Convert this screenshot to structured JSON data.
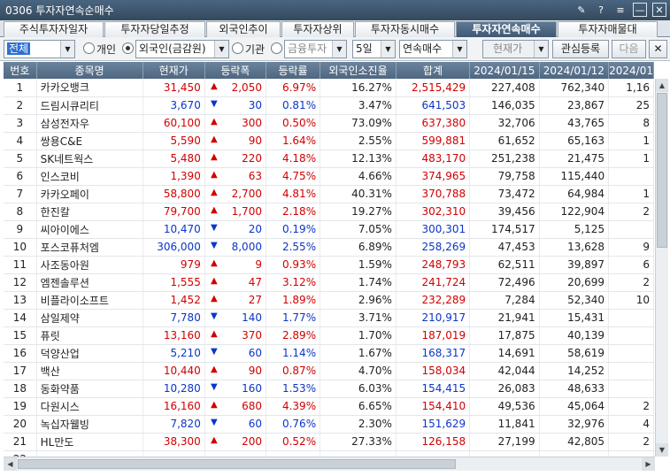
{
  "window": {
    "title": "0306 투자자연속순매수",
    "icons": [
      "pin-icon",
      "help-icon",
      "menu-icon",
      "minimize-icon",
      "close-icon"
    ],
    "icon_glyphs": {
      "pin": "✎",
      "help": "?",
      "menu": "≡",
      "minimize": "—",
      "close": "✕"
    }
  },
  "tabs": [
    {
      "label": "주식투자자일자",
      "active": false
    },
    {
      "label": "투자자당일추정",
      "active": false
    },
    {
      "label": "외국인추이",
      "active": false
    },
    {
      "label": "투자자상위",
      "active": false
    },
    {
      "label": "투자자동시매수",
      "active": false
    },
    {
      "label": "투자자연속매수",
      "active": true
    },
    {
      "label": "투자자매물대",
      "active": false
    }
  ],
  "filters": {
    "market": "전체",
    "radio_individual": "개인",
    "radio_foreign": "외국인(금감원)",
    "radio_institution": "기관",
    "institution_type": "금융투자",
    "period": "5일",
    "mode": "연속매수",
    "price_option": "현재가",
    "watchlist_button": "관심등록",
    "next_button": "다음",
    "selected_radio": "foreign"
  },
  "table": {
    "columns": [
      "번호",
      "종목명",
      "현재가",
      "등락폭",
      "등락률",
      "외국인소진율",
      "합계",
      "2024/01/15",
      "2024/01/12",
      "2024/01"
    ],
    "rows": [
      {
        "no": "1",
        "name": "카카오뱅크",
        "price": "31,450",
        "dir": "up",
        "chg": "2,050",
        "rate": "6.97%",
        "exh": "16.27%",
        "total": "2,515,429",
        "d1": "227,408",
        "d2": "762,340",
        "d3": "1,16"
      },
      {
        "no": "2",
        "name": "드림시큐리티",
        "price": "3,670",
        "dir": "down",
        "chg": "30",
        "rate": "0.81%",
        "exh": "3.47%",
        "total": "641,503",
        "d1": "146,035",
        "d2": "23,867",
        "d3": "25"
      },
      {
        "no": "3",
        "name": "삼성전자우",
        "price": "60,100",
        "dir": "up",
        "chg": "300",
        "rate": "0.50%",
        "exh": "73.09%",
        "total": "637,380",
        "d1": "32,706",
        "d2": "43,765",
        "d3": "8"
      },
      {
        "no": "4",
        "name": "쌍용C&E",
        "price": "5,590",
        "dir": "up",
        "chg": "90",
        "rate": "1.64%",
        "exh": "2.55%",
        "total": "599,881",
        "d1": "61,652",
        "d2": "65,163",
        "d3": "1"
      },
      {
        "no": "5",
        "name": "SK네트웍스",
        "price": "5,480",
        "dir": "up",
        "chg": "220",
        "rate": "4.18%",
        "exh": "12.13%",
        "total": "483,170",
        "d1": "251,238",
        "d2": "21,475",
        "d3": "1"
      },
      {
        "no": "6",
        "name": "인스코비",
        "price": "1,390",
        "dir": "up",
        "chg": "63",
        "rate": "4.75%",
        "exh": "4.66%",
        "total": "374,965",
        "d1": "79,758",
        "d2": "115,440",
        "d3": ""
      },
      {
        "no": "7",
        "name": "카카오페이",
        "price": "58,800",
        "dir": "up",
        "chg": "2,700",
        "rate": "4.81%",
        "exh": "40.31%",
        "total": "370,788",
        "d1": "73,472",
        "d2": "64,984",
        "d3": "1"
      },
      {
        "no": "8",
        "name": "한진칼",
        "price": "79,700",
        "dir": "up",
        "chg": "1,700",
        "rate": "2.18%",
        "exh": "19.27%",
        "total": "302,310",
        "d1": "39,456",
        "d2": "122,904",
        "d3": "2"
      },
      {
        "no": "9",
        "name": "씨아이에스",
        "price": "10,470",
        "dir": "down",
        "chg": "20",
        "rate": "0.19%",
        "exh": "7.05%",
        "total": "300,301",
        "d1": "174,517",
        "d2": "5,125",
        "d3": ""
      },
      {
        "no": "10",
        "name": "포스코퓨처엠",
        "price": "306,000",
        "dir": "down",
        "chg": "8,000",
        "rate": "2.55%",
        "exh": "6.89%",
        "total": "258,269",
        "d1": "47,453",
        "d2": "13,628",
        "d3": "9"
      },
      {
        "no": "11",
        "name": "사조동아원",
        "price": "979",
        "dir": "up",
        "chg": "9",
        "rate": "0.93%",
        "exh": "1.59%",
        "total": "248,793",
        "d1": "62,511",
        "d2": "39,897",
        "d3": "6"
      },
      {
        "no": "12",
        "name": "엠젠솔루션",
        "price": "1,555",
        "dir": "up",
        "chg": "47",
        "rate": "3.12%",
        "exh": "1.74%",
        "total": "241,724",
        "d1": "72,496",
        "d2": "20,699",
        "d3": "2"
      },
      {
        "no": "13",
        "name": "비플라이소프트",
        "price": "1,452",
        "dir": "up",
        "chg": "27",
        "rate": "1.89%",
        "exh": "2.96%",
        "total": "232,289",
        "d1": "7,284",
        "d2": "52,340",
        "d3": "10"
      },
      {
        "no": "14",
        "name": "삼일제약",
        "price": "7,780",
        "dir": "down",
        "chg": "140",
        "rate": "1.77%",
        "exh": "3.71%",
        "total": "210,917",
        "d1": "21,941",
        "d2": "15,431",
        "d3": ""
      },
      {
        "no": "15",
        "name": "퓨릿",
        "price": "13,160",
        "dir": "up",
        "chg": "370",
        "rate": "2.89%",
        "exh": "1.70%",
        "total": "187,019",
        "d1": "17,875",
        "d2": "40,139",
        "d3": ""
      },
      {
        "no": "16",
        "name": "덕양산업",
        "price": "5,210",
        "dir": "down",
        "chg": "60",
        "rate": "1.14%",
        "exh": "1.67%",
        "total": "168,317",
        "d1": "14,691",
        "d2": "58,619",
        "d3": ""
      },
      {
        "no": "17",
        "name": "백산",
        "price": "10,440",
        "dir": "up",
        "chg": "90",
        "rate": "0.87%",
        "exh": "4.70%",
        "total": "158,034",
        "d1": "42,044",
        "d2": "14,252",
        "d3": ""
      },
      {
        "no": "18",
        "name": "동화약품",
        "price": "10,280",
        "dir": "down",
        "chg": "160",
        "rate": "1.53%",
        "exh": "6.03%",
        "total": "154,415",
        "d1": "26,083",
        "d2": "48,633",
        "d3": ""
      },
      {
        "no": "19",
        "name": "다원시스",
        "price": "16,160",
        "dir": "up",
        "chg": "680",
        "rate": "4.39%",
        "exh": "6.65%",
        "total": "154,410",
        "d1": "49,536",
        "d2": "45,064",
        "d3": "2"
      },
      {
        "no": "20",
        "name": "녹십자웰빙",
        "price": "7,820",
        "dir": "down",
        "chg": "60",
        "rate": "0.76%",
        "exh": "2.30%",
        "total": "151,629",
        "d1": "11,841",
        "d2": "32,976",
        "d3": "4"
      },
      {
        "no": "21",
        "name": "HL만도",
        "price": "38,300",
        "dir": "up",
        "chg": "200",
        "rate": "0.52%",
        "exh": "27.33%",
        "total": "126,158",
        "d1": "27,199",
        "d2": "42,805",
        "d3": "2"
      },
      {
        "no": "22",
        "name": "",
        "price": "",
        "dir": "up",
        "chg": "",
        "rate": "",
        "exh": "",
        "total": "",
        "d1": "",
        "d2": "",
        "d3": ""
      }
    ]
  },
  "colors": {
    "up": "#d10000",
    "down": "#0a36c8",
    "header": "#4f6780",
    "active_tab": "#3f5873"
  }
}
